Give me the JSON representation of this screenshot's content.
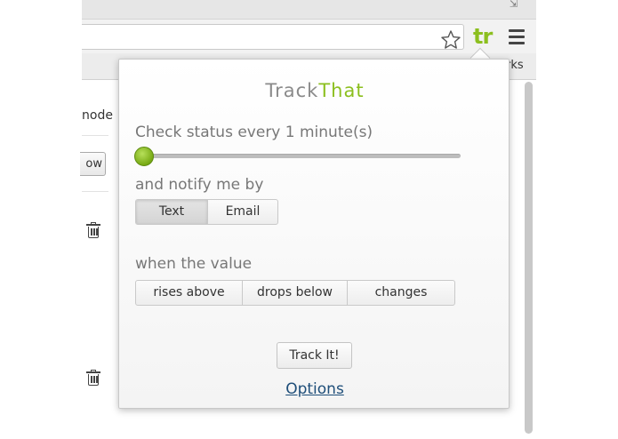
{
  "browser": {
    "bookmarks_fragment": "rks",
    "restore_glyph": "⇲",
    "ext_icon_text": "tr",
    "accent_color": "#8cbf1f"
  },
  "page": {
    "mode_text": "node",
    "partial_button": "ow"
  },
  "popup": {
    "brand_track": "Track",
    "brand_that": "That",
    "check_status_label": "Check status every 1 minute(s)",
    "interval_minutes": 1,
    "notify_label": "and notify me by",
    "notify_options": [
      "Text",
      "Email"
    ],
    "notify_selected": "Text",
    "when_label": "when the value",
    "condition_options": [
      "rises above",
      "drops below",
      "changes"
    ],
    "track_button": "Track It!",
    "options_link": "Options"
  }
}
